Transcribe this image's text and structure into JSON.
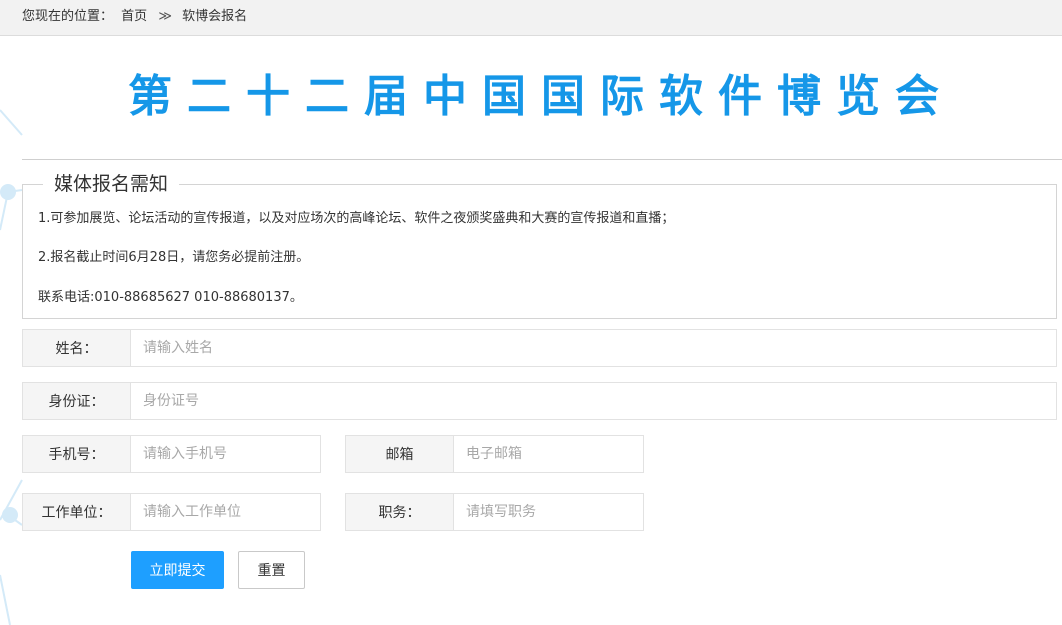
{
  "breadcrumb": {
    "prefix": "您现在的位置：",
    "home": "首页",
    "separator": "≫",
    "current": "软博会报名"
  },
  "page": {
    "title": "第二十二届中国国际软件博览会"
  },
  "notice": {
    "legend": "媒体报名需知",
    "lines": [
      "1.可参加展览、论坛活动的宣传报道，以及对应场次的高峰论坛、软件之夜颁奖盛典和大赛的宣传报道和直播；",
      "2.报名截止时间6月28日，请您务必提前注册。",
      "联系电话:010-88685627 010-88680137。"
    ]
  },
  "form": {
    "name": {
      "label": "姓名：",
      "placeholder": "请输入姓名",
      "value": ""
    },
    "id_card": {
      "label": "身份证：",
      "placeholder": "身份证号",
      "value": ""
    },
    "phone": {
      "label": "手机号：",
      "placeholder": "请输入手机号",
      "value": ""
    },
    "email": {
      "label": "邮箱",
      "placeholder": "电子邮箱",
      "value": ""
    },
    "company": {
      "label": "工作单位：",
      "placeholder": "请输入工作单位",
      "value": ""
    },
    "position": {
      "label": "职务：",
      "placeholder": "请填写职务",
      "value": ""
    },
    "submit_label": "立即提交",
    "reset_label": "重置"
  },
  "colors": {
    "accent": "#1597e8",
    "button_primary": "#1e9fff",
    "decoration": "#cfe8f7"
  }
}
